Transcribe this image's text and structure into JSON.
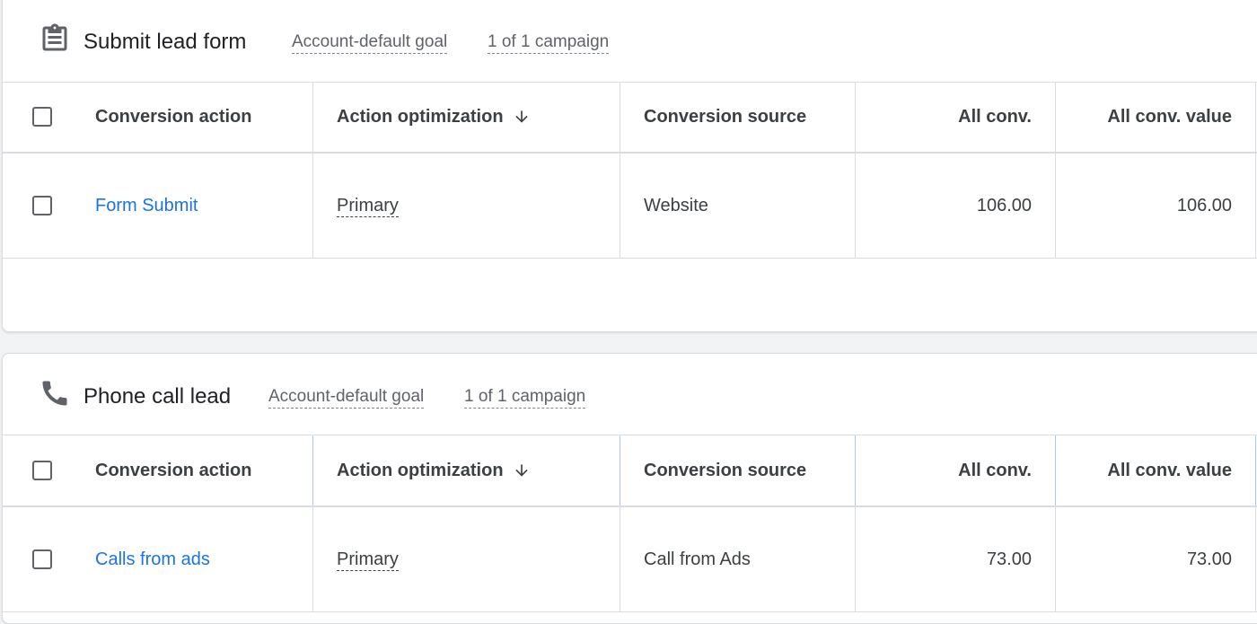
{
  "goals": [
    {
      "title": "Submit lead form",
      "icon": "clipboard-icon",
      "default_goal_label": "Account-default goal",
      "campaign_label": "1 of 1 campaign",
      "columns": {
        "conversion_action": "Conversion action",
        "action_optimization": "Action optimization",
        "conversion_source": "Conversion source",
        "all_conv": "All conv.",
        "all_conv_value": "All conv. value"
      },
      "rows": [
        {
          "conversion_action": "Form Submit",
          "action_optimization": "Primary",
          "conversion_source": "Website",
          "all_conv": "106.00",
          "all_conv_value": "106.00"
        }
      ]
    },
    {
      "title": "Phone call lead",
      "icon": "phone-icon",
      "default_goal_label": "Account-default goal",
      "campaign_label": "1 of 1 campaign",
      "columns": {
        "conversion_action": "Conversion action",
        "action_optimization": "Action optimization",
        "conversion_source": "Conversion source",
        "all_conv": "All conv.",
        "all_conv_value": "All conv. value"
      },
      "rows": [
        {
          "conversion_action": "Calls from ads",
          "action_optimization": "Primary",
          "conversion_source": "Call from Ads",
          "all_conv": "73.00",
          "all_conv_value": "73.00"
        }
      ]
    }
  ],
  "colors": {
    "link": "#1a73e8",
    "text": "#202124",
    "muted": "#5f6368",
    "border": "#dadce0",
    "background": "#f1f3f4"
  }
}
